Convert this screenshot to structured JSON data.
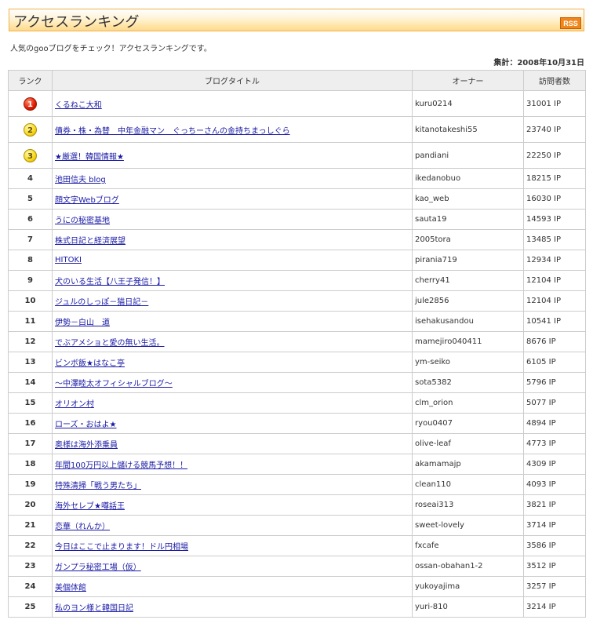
{
  "header": {
    "title": "アクセスランキング",
    "rss_label": "RSS"
  },
  "intro": "人気のgooブログをチェック！アクセスランキングです。",
  "as_of": "集計：2008年10月31日",
  "columns": {
    "rank": "ランク",
    "title": "ブログタイトル",
    "owner": "オーナー",
    "views": "訪問者数"
  },
  "rows": [
    {
      "rank": "1",
      "title": "くるねこ大和",
      "owner": "kuru0214",
      "views": "31001 IP"
    },
    {
      "rank": "2",
      "title": "債券・株・為替　中年金融マン　ぐっちーさんの金持ちまっしぐら",
      "owner": "kitanotakeshi55",
      "views": "23740 IP"
    },
    {
      "rank": "3",
      "title": "★厳選！韓国情報★",
      "owner": "pandiani",
      "views": "22250 IP"
    },
    {
      "rank": "4",
      "title": "池田信夫 blog",
      "owner": "ikedanobuo",
      "views": "18215 IP"
    },
    {
      "rank": "5",
      "title": "顔文字Webブログ",
      "owner": "kao_web",
      "views": "16030 IP"
    },
    {
      "rank": "6",
      "title": "うにの秘密基地",
      "owner": "sauta19",
      "views": "14593 IP"
    },
    {
      "rank": "7",
      "title": "株式日記と経済展望",
      "owner": "2005tora",
      "views": "13485 IP"
    },
    {
      "rank": "8",
      "title": "HITOKI",
      "owner": "pirania719",
      "views": "12934 IP"
    },
    {
      "rank": "9",
      "title": "犬のいる生活【八王子発信！】",
      "owner": "cherry41",
      "views": "12104 IP"
    },
    {
      "rank": "10",
      "title": "ジュルのしっぽ－猫日記－",
      "owner": "jule2856",
      "views": "12104 IP"
    },
    {
      "rank": "11",
      "title": "伊勢－白山　道",
      "owner": "isehakusandou",
      "views": "10541 IP"
    },
    {
      "rank": "12",
      "title": "でぶアメショと愛の無い生活。",
      "owner": "mamejiro040411",
      "views": "8676 IP"
    },
    {
      "rank": "13",
      "title": "ビンボ飯★はなこ亭",
      "owner": "ym-seiko",
      "views": "6105 IP"
    },
    {
      "rank": "14",
      "title": "～中澤睦太オフィシャルブログ～",
      "owner": "sota5382",
      "views": "5796 IP"
    },
    {
      "rank": "15",
      "title": "オリオン村",
      "owner": "clm_orion",
      "views": "5077 IP"
    },
    {
      "rank": "16",
      "title": "ローズ・おはよ★",
      "owner": "ryou0407",
      "views": "4894 IP"
    },
    {
      "rank": "17",
      "title": "奥様は海外添乗員",
      "owner": "olive-leaf",
      "views": "4773 IP"
    },
    {
      "rank": "18",
      "title": "年間100万円以上儲ける競馬予想！！",
      "owner": "akamamajp",
      "views": "4309 IP"
    },
    {
      "rank": "19",
      "title": "特殊清掃「戦う男たち」",
      "owner": "clean110",
      "views": "4093 IP"
    },
    {
      "rank": "20",
      "title": "海外セレブ★噂話王",
      "owner": "roseai313",
      "views": "3821 IP"
    },
    {
      "rank": "21",
      "title": "恋華（れんか）",
      "owner": "sweet-lovely",
      "views": "3714 IP"
    },
    {
      "rank": "22",
      "title": "今日はここで止まります！ドル円相場",
      "owner": "fxcafe",
      "views": "3586 IP"
    },
    {
      "rank": "23",
      "title": "ガンプラ秘密工場（仮）",
      "owner": "ossan-obahan1-2",
      "views": "3512 IP"
    },
    {
      "rank": "24",
      "title": "美個体館",
      "owner": "yukoyajima",
      "views": "3257 IP"
    },
    {
      "rank": "25",
      "title": "私のヨン様と韓国日記",
      "owner": "yuri-810",
      "views": "3214 IP"
    }
  ]
}
